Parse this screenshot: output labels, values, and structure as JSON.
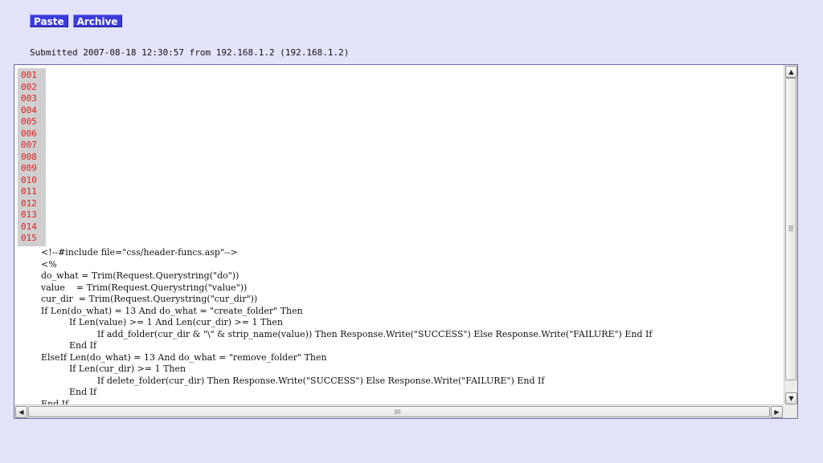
{
  "nav": {
    "paste_label": "Paste",
    "archive_label": "Archive"
  },
  "submission": {
    "info": "Submitted 2007-08-18 12:30:57 from 192.168.1.2 (192.168.1.2)"
  },
  "code": {
    "line_numbers": [
      "001",
      "002",
      "003",
      "004",
      "005",
      "006",
      "007",
      "008",
      "009",
      "010",
      "011",
      "012",
      "013",
      "014",
      "015"
    ],
    "lines": [
      "  <!--#include file=\"css/header-funcs.asp\"-->",
      "  <%",
      "  do_what = Trim(Request.Querystring(\"do\"))",
      "  value    = Trim(Request.Querystring(\"value\"))",
      "  cur_dir  = Trim(Request.Querystring(\"cur_dir\"))",
      "  If Len(do_what) = 13 And do_what = \"create_folder\" Then",
      "            If Len(value) >= 1 And Len(cur_dir) >= 1 Then",
      "                      If add_folder(cur_dir & \"\\\" & strip_name(value)) Then Response.Write(\"SUCCESS\") Else Response.Write(\"FAILURE\") End If",
      "            End If",
      "  ElseIf Len(do_what) = 13 And do_what = \"remove_folder\" Then",
      "            If Len(cur_dir) >= 1 Then",
      "                      If delete_folder(cur_dir) Then Response.Write(\"SUCCESS\") Else Response.Write(\"FAILURE\") End If",
      "            End If",
      "  End If"
    ]
  },
  "scrollbars": {
    "up_icon": "▲",
    "down_icon": "▼",
    "left_icon": "◀",
    "right_icon": "▶"
  },
  "colors": {
    "page_background": "#e3e3fb",
    "nav_button": "#3b3bdc",
    "line_number_text": "#e02020",
    "line_number_background": "#cfcfcf"
  }
}
